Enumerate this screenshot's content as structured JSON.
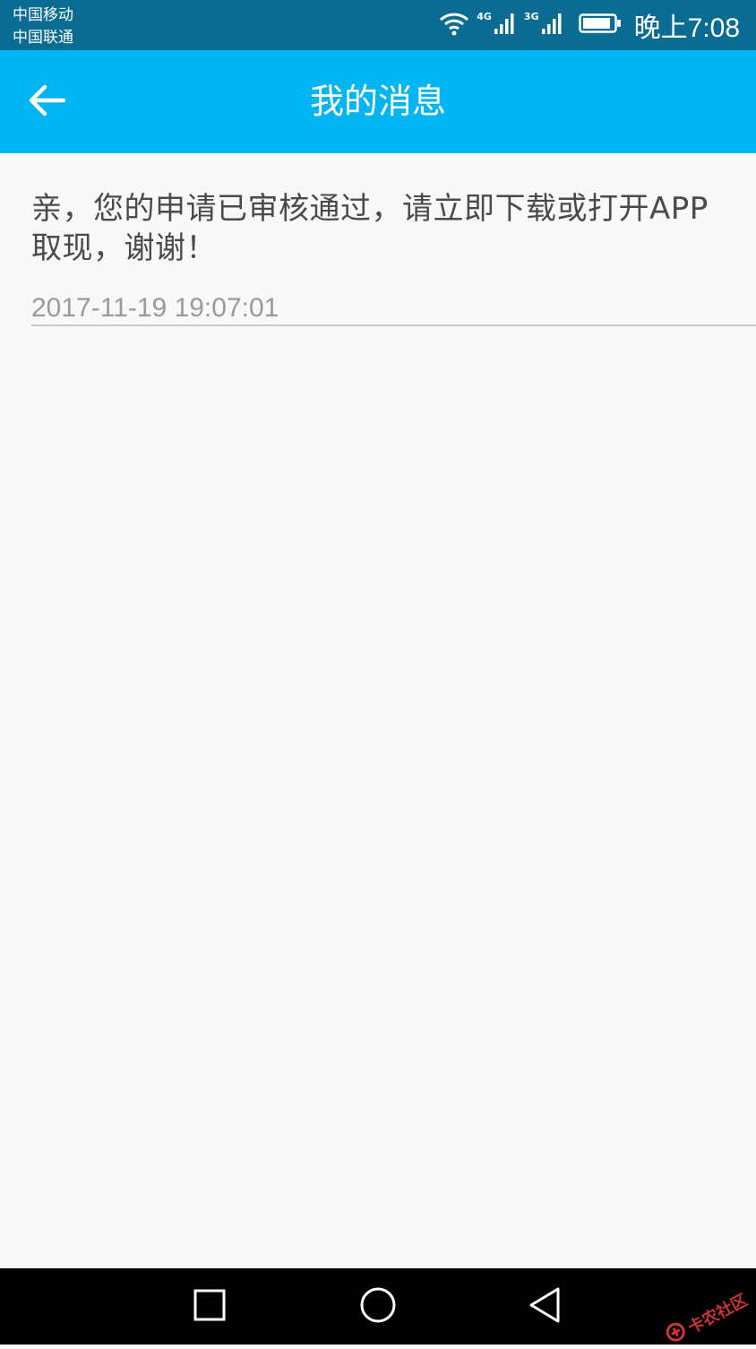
{
  "status_bar": {
    "carrier_1": "中国移动",
    "carrier_2": "中国联通",
    "network_1": "4G",
    "network_2": "3G",
    "time": "晚上7:08",
    "icons": [
      "wifi-icon",
      "signal-icon",
      "signal-icon",
      "battery-icon"
    ]
  },
  "app_bar": {
    "title": "我的消息",
    "back_icon": "arrow-left-icon",
    "color": "#00b5f2"
  },
  "messages": [
    {
      "text": "亲，您的申请已审核通过，请立即下载或打开APP取现，谢谢！",
      "time": "2017-11-19 19:07:01"
    }
  ],
  "nav_bar": {
    "buttons": [
      "recent-apps-icon",
      "home-icon",
      "back-triangle-icon"
    ]
  },
  "watermark": {
    "text": "卡农社区"
  },
  "colors": {
    "status_bar": "#0a6c93",
    "accent": "#00b5f2",
    "background": "#f8f8f8",
    "text": "#4a4a4a",
    "secondary_text": "#9a9a9a"
  }
}
